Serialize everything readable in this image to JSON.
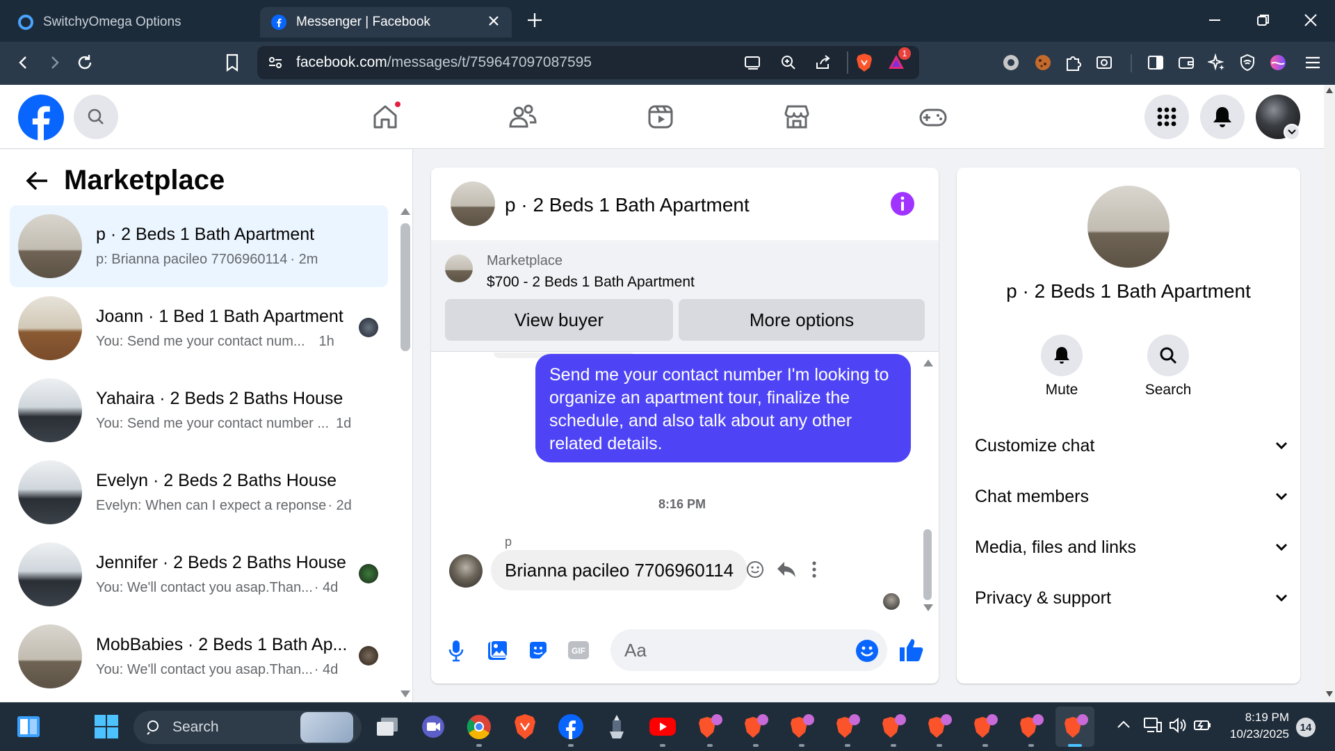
{
  "browser": {
    "tabs": [
      {
        "title": "SwitchyOmega Options",
        "active": false
      },
      {
        "title": "Messenger | Facebook",
        "active": true
      }
    ],
    "url_host": "facebook.com",
    "url_path": "/messages/t/759647097087595",
    "brave_badge": "1"
  },
  "left": {
    "title": "Marketplace",
    "conversations": [
      {
        "name": "p · 2 Beds 1 Bath Apartment",
        "preview": "p: Brianna pacileo 7706960114",
        "time": "· 2m"
      },
      {
        "name": "Joann · 1 Bed 1 Bath Apartment",
        "preview": "You: Send me your contact num...",
        "time": "1h"
      },
      {
        "name": "Yahaira · 2 Beds 2 Baths House",
        "preview": "You: Send me your contact number ...",
        "time": "1d"
      },
      {
        "name": "Evelyn · 2 Beds 2 Baths House",
        "preview": "Evelyn: When can I expect a reponse",
        "time": "· 2d"
      },
      {
        "name": "Jennifer · 2 Beds 2 Baths House",
        "preview": "You: We'll contact you asap.Than...",
        "time": "· 4d"
      },
      {
        "name": "MobBabies · 2 Beds 1 Bath Ap...",
        "preview": "You: We'll contact you asap.Than...",
        "time": "· 4d"
      }
    ]
  },
  "chat": {
    "title": "p · 2 Beds 1 Bath Apartment",
    "listing_label": "Marketplace",
    "listing_title": "$700 - 2 Beds 1 Bath Apartment",
    "view_buyer": "View buyer",
    "more_options": "More options",
    "outgoing_message": "Send me your contact number I'm looking to organize an apartment tour, finalize the schedule, and also talk about any other related details.",
    "timestamp": "8:16 PM",
    "sender_label": "p",
    "incoming_message": "Brianna pacileo 7706960114",
    "composer_placeholder": "Aa"
  },
  "right": {
    "title": "p · 2 Beds 1 Bath Apartment",
    "mute": "Mute",
    "search": "Search",
    "sections": [
      "Customize chat",
      "Chat members",
      "Media, files and links",
      "Privacy & support"
    ]
  },
  "taskbar": {
    "search": "Search",
    "time": "8:19 PM",
    "date": "10/23/2025",
    "notif_count": "14"
  },
  "colors": {
    "fb_blue": "#0866ff",
    "messenger_purple": "#4e44f5",
    "info_purple": "#a033ff",
    "notif_red": "#e41e3f"
  }
}
